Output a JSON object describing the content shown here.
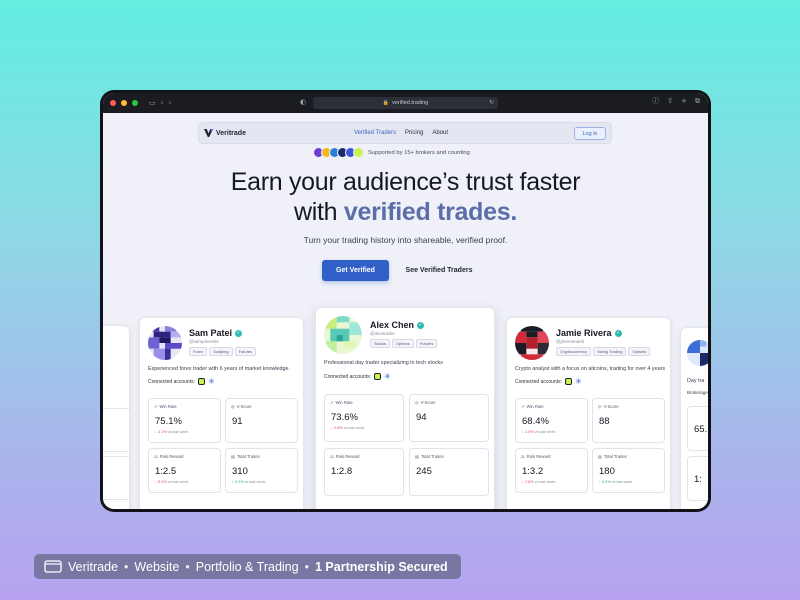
{
  "browser": {
    "url": "verified.trading",
    "traffic_lights": [
      "#ff5f57",
      "#febc2e",
      "#28c840"
    ]
  },
  "nav": {
    "brand": "Veritrade",
    "links": [
      "Verified Traders",
      "Pricing",
      "About"
    ],
    "active_link": "Verified Traders",
    "login_label": "Log in"
  },
  "hero": {
    "supported_text": "Supported by 15+ brokers and counting",
    "title_line1": "Earn your audience’s trust faster",
    "title_line2_prefix": "with",
    "title_line2_accent": "verified trades.",
    "subtitle": "Turn your trading history into shareable, verified proof.",
    "cta_primary": "Get Verified",
    "cta_secondary": "See Verified Traders"
  },
  "traders": [
    {
      "name": "Sam Patel",
      "handle": "@sampinvests",
      "tags": [
        "Forex",
        "Scalping",
        "Futures"
      ],
      "bio": "Experienced forex trader with 6 years of market knowledge.",
      "connected_label": "Connected accounts:",
      "stats": [
        {
          "label": "Win Rate",
          "value": "75.1%",
          "change": "3.1%",
          "dir": "down",
          "suffix": "vs last week"
        },
        {
          "label": "V-Score",
          "value": "91"
        },
        {
          "label": "Risk Reward",
          "value": "1:2.5",
          "change": "5.2%",
          "dir": "down",
          "suffix": "vs last week"
        },
        {
          "label": "Total Trades",
          "value": "310",
          "change": "9.2%",
          "dir": "up",
          "suffix": "vs last week"
        }
      ]
    },
    {
      "name": "Alex Chen",
      "handle": "@alextrader",
      "tags": [
        "Stocks",
        "Options",
        "Futures"
      ],
      "bio": "Professional day trader specializing in tech stocks",
      "connected_label": "Connected accounts:",
      "stats": [
        {
          "label": "Win Rate",
          "value": "73.6%",
          "change": "2.6%",
          "dir": "down",
          "suffix": "vs last week"
        },
        {
          "label": "V-Score",
          "value": "94"
        },
        {
          "label": "Risk Reward",
          "value": "1:2.8"
        },
        {
          "label": "Total Trades",
          "value": "245"
        }
      ]
    },
    {
      "name": "Jamie Rivera",
      "handle": "@jriveramarkt",
      "tags": [
        "Cryptocurrency",
        "Swing Trading",
        "Options"
      ],
      "bio": "Crypto analyst with a focus on altcoins, trading for over 4 years",
      "connected_label": "Connected accounts:",
      "stats": [
        {
          "label": "Win Rate",
          "value": "68.4%",
          "change": "1.5%",
          "dir": "down",
          "suffix": "vs last week"
        },
        {
          "label": "V-Score",
          "value": "88"
        },
        {
          "label": "Risk Reward",
          "value": "1:3.2",
          "change": "2.8%",
          "dir": "down",
          "suffix": "vs last week"
        },
        {
          "label": "Total Trades",
          "value": "180",
          "change": "6.2%",
          "dir": "up",
          "suffix": "vs last week"
        }
      ]
    }
  ],
  "partial_right": {
    "bio_fragment": "Day tra",
    "sub_fragment": "Brokerage",
    "value_fragment": "65.",
    "value2_fragment": "1:"
  },
  "footer": {
    "items": [
      "Veritrade",
      "Website",
      "Portfolio & Trading"
    ],
    "highlight": "1 Partnership Secured"
  }
}
